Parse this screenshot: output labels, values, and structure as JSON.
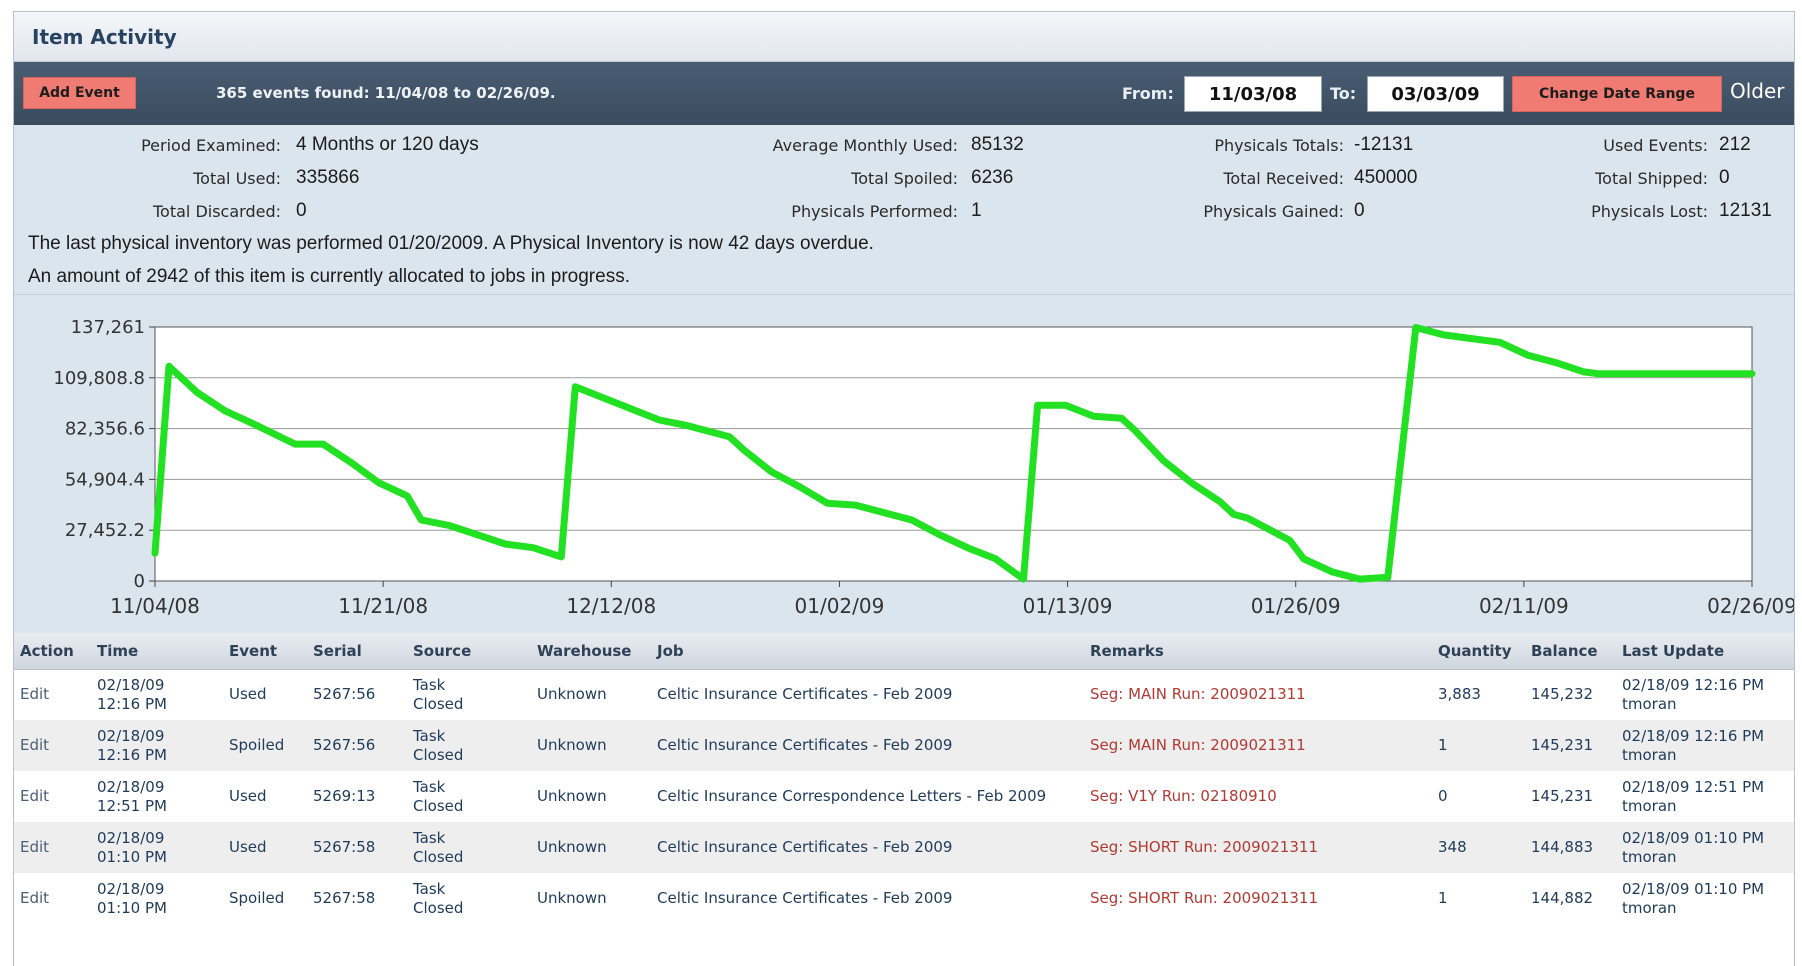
{
  "panel": {
    "title": "Item Activity"
  },
  "toolbar": {
    "add_event_label": "Add Event",
    "events_found": "365 events found: 11/04/08 to 02/26/09.",
    "from_label": "From:",
    "from_value": "11/03/08",
    "to_label": "To:",
    "to_value": "03/03/09",
    "change_range_label": "Change Date Range",
    "older_label": "Older"
  },
  "summary": {
    "period_examined_label": "Period Examined:",
    "period_examined_value": "4 Months or 120 days",
    "total_used_label": "Total Used:",
    "total_used_value": "335866",
    "total_discarded_label": "Total Discarded:",
    "total_discarded_value": "0",
    "avg_monthly_used_label": "Average Monthly Used:",
    "avg_monthly_used_value": "85132",
    "total_spoiled_label": "Total Spoiled:",
    "total_spoiled_value": "6236",
    "physicals_performed_label": "Physicals Performed:",
    "physicals_performed_value": "1",
    "physicals_totals_label": "Physicals Totals:",
    "physicals_totals_value": "-12131",
    "total_received_label": "Total Received:",
    "total_received_value": "450000",
    "physicals_gained_label": "Physicals Gained:",
    "physicals_gained_value": "0",
    "used_events_label": "Used Events:",
    "used_events_value": "212",
    "total_shipped_label": "Total Shipped:",
    "total_shipped_value": "0",
    "physicals_lost_label": "Physicals Lost:",
    "physicals_lost_value": "12131",
    "last_physical_note": "The last physical inventory was performed 01/20/2009. A Physical Inventory is now 42 days overdue.",
    "allocated_note": "An amount of 2942 of this item is currently allocated to jobs in progress."
  },
  "chart_data": {
    "type": "line",
    "title": "",
    "xlabel": "",
    "ylabel": "",
    "ylim": [
      0,
      137261
    ],
    "xlim": [
      "11/04/08",
      "02/26/09"
    ],
    "y_ticks": [
      "0",
      "27,452.2",
      "54,904.4",
      "82,356.6",
      "109,808.8",
      "137,261"
    ],
    "x_ticks": [
      "11/04/08",
      "11/21/08",
      "12/12/08",
      "01/02/09",
      "01/13/09",
      "01/26/09",
      "02/11/09",
      "02/26/09"
    ],
    "grid": true,
    "line_color": "#22e022",
    "series": [
      {
        "x": [
          "11/04/08",
          "11/05/08",
          "11/07/08",
          "11/09/08",
          "11/11/08",
          "11/14/08",
          "11/16/08",
          "11/18/08",
          "11/20/08",
          "11/22/08",
          "11/23/08",
          "11/25/08",
          "11/27/08",
          "11/29/08",
          "12/01/08",
          "12/03/08",
          "12/04/08",
          "12/07/08",
          "12/10/08",
          "12/12/08",
          "12/15/08",
          "12/16/08",
          "12/18/08",
          "12/20/08",
          "12/22/08",
          "12/24/08",
          "12/26/08",
          "12/28/08",
          "12/30/08",
          "01/01/09",
          "01/03/09",
          "01/05/09",
          "01/06/09",
          "01/08/09",
          "01/10/09",
          "01/12/09",
          "01/13/09",
          "01/15/09",
          "01/17/09",
          "01/19/09",
          "01/20/09",
          "01/21/09",
          "01/24/09",
          "01/25/09",
          "01/27/09",
          "01/29/09",
          "01/31/09",
          "02/02/09",
          "02/04/09",
          "02/06/09",
          "02/08/09",
          "02/10/09",
          "02/12/09",
          "02/14/09",
          "02/15/09",
          "02/16/09",
          "02/18/09",
          "02/19/09",
          "02/20/09",
          "02/21/09",
          "02/22/09",
          "02/24/09",
          "02/26/09"
        ],
        "values": [
          15000,
          116000,
          102000,
          92000,
          85000,
          74000,
          74000,
          64000,
          53000,
          46000,
          33000,
          30000,
          25000,
          20000,
          18000,
          13000,
          105000,
          96000,
          87000,
          84000,
          78000,
          71000,
          59000,
          51000,
          42000,
          41000,
          37000,
          33000,
          25000,
          18000,
          12000,
          1000,
          95000,
          95000,
          89000,
          88000,
          81000,
          65000,
          53000,
          43000,
          36000,
          34000,
          22000,
          12000,
          5000,
          1000,
          2000,
          137000,
          133000,
          131000,
          129000,
          122000,
          118000,
          113000,
          112000,
          112000,
          112000,
          112000,
          112000,
          112000,
          112000,
          112000,
          112000
        ]
      }
    ]
  },
  "table": {
    "columns": [
      "Action",
      "Time",
      "Event",
      "Serial",
      "Source",
      "Warehouse",
      "Job",
      "Remarks",
      "Quantity",
      "Balance",
      "Last Update"
    ],
    "rows": [
      {
        "action": "Edit",
        "time_date": "02/18/09",
        "time_clock": "12:16 PM",
        "event": "Used",
        "serial": "5267:56",
        "source_a": "Task",
        "source_b": "Closed",
        "warehouse": "Unknown",
        "job": "Celtic Insurance Certificates - Feb 2009",
        "remarks": "Seg: MAIN Run: 2009021311",
        "quantity": "3,883",
        "balance": "145,232",
        "update_time": "02/18/09 12:16 PM",
        "update_user": "tmoran"
      },
      {
        "action": "Edit",
        "time_date": "02/18/09",
        "time_clock": "12:16 PM",
        "event": "Spoiled",
        "serial": "5267:56",
        "source_a": "Task",
        "source_b": "Closed",
        "warehouse": "Unknown",
        "job": "Celtic Insurance Certificates - Feb 2009",
        "remarks": "Seg: MAIN Run: 2009021311",
        "quantity": "1",
        "balance": "145,231",
        "update_time": "02/18/09 12:16 PM",
        "update_user": "tmoran"
      },
      {
        "action": "Edit",
        "time_date": "02/18/09",
        "time_clock": "12:51 PM",
        "event": "Used",
        "serial": "5269:13",
        "source_a": "Task",
        "source_b": "Closed",
        "warehouse": "Unknown",
        "job": "Celtic Insurance Correspondence Letters - Feb 2009",
        "remarks": "Seg: V1Y Run: 02180910",
        "quantity": "0",
        "balance": "145,231",
        "update_time": "02/18/09 12:51 PM",
        "update_user": "tmoran"
      },
      {
        "action": "Edit",
        "time_date": "02/18/09",
        "time_clock": "01:10 PM",
        "event": "Used",
        "serial": "5267:58",
        "source_a": "Task",
        "source_b": "Closed",
        "warehouse": "Unknown",
        "job": "Celtic Insurance Certificates - Feb 2009",
        "remarks": "Seg: SHORT Run: 2009021311",
        "quantity": "348",
        "balance": "144,883",
        "update_time": "02/18/09 01:10 PM",
        "update_user": "tmoran"
      },
      {
        "action": "Edit",
        "time_date": "02/18/09",
        "time_clock": "01:10 PM",
        "event": "Spoiled",
        "serial": "5267:58",
        "source_a": "Task",
        "source_b": "Closed",
        "warehouse": "Unknown",
        "job": "Celtic Insurance Certificates - Feb 2009",
        "remarks": "Seg: SHORT Run: 2009021311",
        "quantity": "1",
        "balance": "144,882",
        "update_time": "02/18/09 01:10 PM",
        "update_user": "tmoran"
      }
    ]
  }
}
